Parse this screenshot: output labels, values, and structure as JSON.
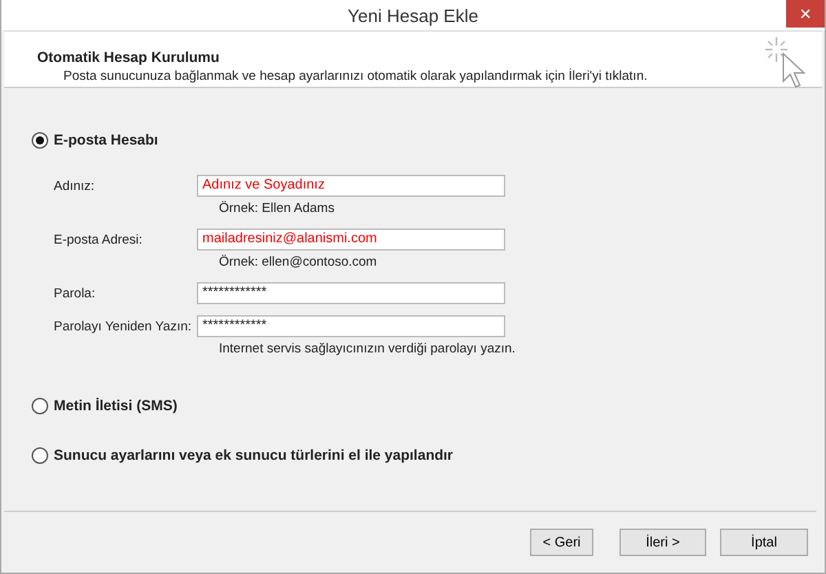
{
  "window": {
    "title": "Yeni Hesap Ekle",
    "close": "✕"
  },
  "header": {
    "title": "Otomatik Hesap Kurulumu",
    "subtitle": "Posta sunucunuza bağlanmak ve hesap ayarlarınızı otomatik olarak yapılandırmak için İleri'yi tıklatın."
  },
  "options": [
    {
      "label": "E-posta Hesabı",
      "selected": true,
      "fields": [
        {
          "label": "Adınız:",
          "value": "Adınız ve Soyadınız",
          "kind": "text",
          "hint": "Örnek: Ellen Adams"
        },
        {
          "label": "E-posta Adresi:",
          "value": "mailadresiniz@alanismi.com",
          "kind": "text",
          "hint": "Örnek: ellen@contoso.com"
        },
        {
          "label": "Parola:",
          "value": "************",
          "kind": "password"
        },
        {
          "label": "Parolayı Yeniden Yazın:",
          "value": "************",
          "kind": "password",
          "hint": "Internet servis sağlayıcınızın verdiği parolayı yazın."
        }
      ]
    },
    {
      "label": "Metin İletisi (SMS)",
      "selected": false
    },
    {
      "label": "Sunucu ayarlarını veya ek sunucu türlerini el ile yapılandır",
      "selected": false
    }
  ],
  "buttons": [
    "< Geri",
    "İleri >",
    "İptal"
  ]
}
